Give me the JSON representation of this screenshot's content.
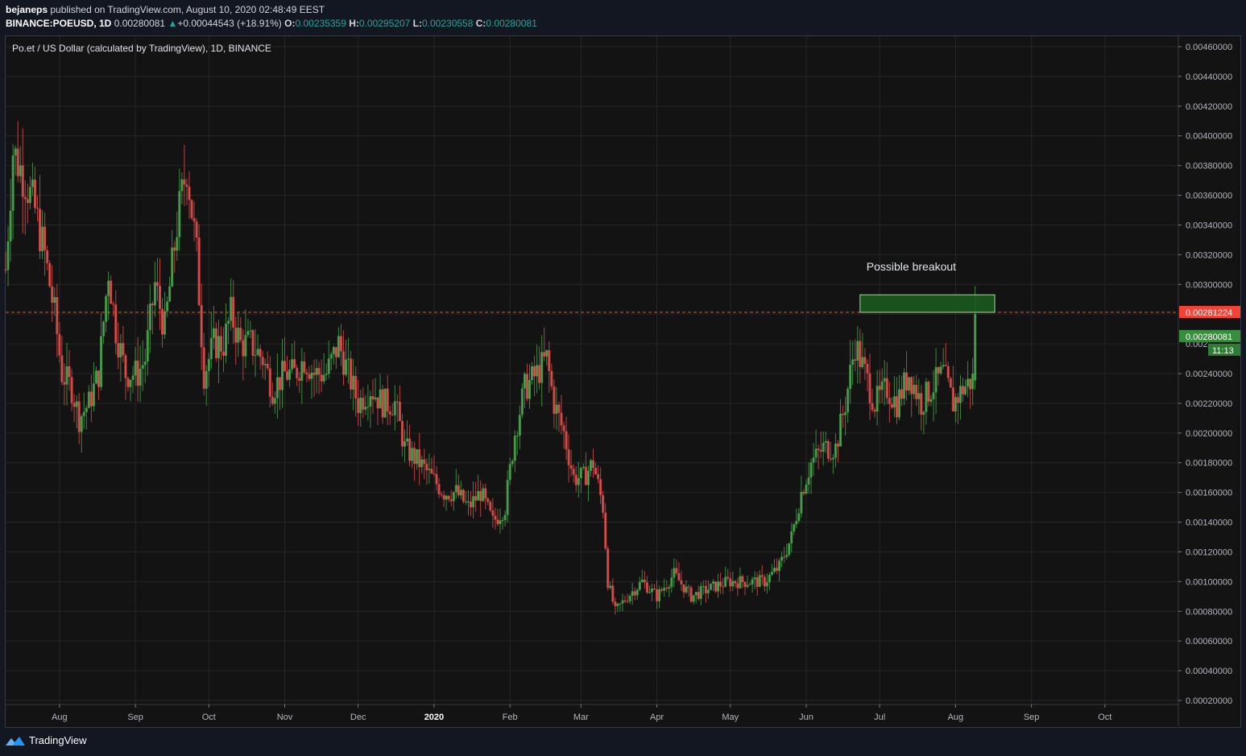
{
  "header": {
    "author": "bejaneps",
    "published_text": "published on TradingView.com, August 10, 2020 02:48:49 EEST",
    "symbol": "BINANCE:POEUSD, 1D",
    "last": "0.00280081",
    "change_arrow": "▲",
    "change": "+0.00044543 (+18.91%)",
    "o_label": "O:",
    "o_value": "0.00235359",
    "h_label": "H:",
    "h_value": "0.00295207",
    "l_label": "L:",
    "l_value": "0.00230558",
    "c_label": "C:",
    "c_value": "0.00280081"
  },
  "legend": "Po.et / US Dollar (calculated by TradingView), 1D, BINANCE",
  "annotation": "Possible breakout",
  "price_labels": {
    "resistance": "0.00281224",
    "last": "0.00280081",
    "countdown": "11:13"
  },
  "footer": {
    "brand": "TradingView",
    "logo_icon": "tradingview-logo-icon"
  },
  "colors": {
    "background": "#131313",
    "grid": "#262626",
    "up": "#4caf50",
    "down": "#ef5350",
    "resistance": "#f4511e",
    "breakout_box": "#1b5e20"
  },
  "chart_data": {
    "type": "candlestick",
    "yaxis": {
      "ylim": [
        0.0002,
        0.0046
      ],
      "ticks": [
        "0.00460000",
        "0.00440000",
        "0.00420000",
        "0.00400000",
        "0.00380000",
        "0.00360000",
        "0.00340000",
        "0.00320000",
        "0.00300000",
        "0.00240000",
        "0.00220000",
        "0.00200000",
        "0.00180000",
        "0.00160000",
        "0.00140000",
        "0.00120000",
        "0.00100000",
        "0.00080000",
        "0.00060000",
        "0.00040000",
        "0.00020000"
      ],
      "tick_values": [
        0.0046,
        0.0044,
        0.0042,
        0.004,
        0.0038,
        0.0036,
        0.0034,
        0.0032,
        0.003,
        0.0024,
        0.0022,
        0.002,
        0.0018,
        0.0016,
        0.0014,
        0.0012,
        0.001,
        0.0008,
        0.0006,
        0.0004,
        0.0002
      ]
    },
    "xaxis": {
      "range": [
        "2019-07-10",
        "2020-10-31"
      ],
      "ticks": [
        {
          "label": "Aug",
          "date": "2019-08-01"
        },
        {
          "label": "Sep",
          "date": "2019-09-01"
        },
        {
          "label": "Oct",
          "date": "2019-10-01"
        },
        {
          "label": "Nov",
          "date": "2019-11-01"
        },
        {
          "label": "Dec",
          "date": "2019-12-01"
        },
        {
          "label": "2020",
          "date": "2020-01-01",
          "bold": true
        },
        {
          "label": "Feb",
          "date": "2020-02-01"
        },
        {
          "label": "Mar",
          "date": "2020-03-01"
        },
        {
          "label": "Apr",
          "date": "2020-04-01"
        },
        {
          "label": "May",
          "date": "2020-05-01"
        },
        {
          "label": "Jun",
          "date": "2020-06-01"
        },
        {
          "label": "Jul",
          "date": "2020-07-01"
        },
        {
          "label": "Aug",
          "date": "2020-08-01"
        },
        {
          "label": "Sep",
          "date": "2020-09-01"
        },
        {
          "label": "Oct",
          "date": "2020-10-01"
        }
      ]
    },
    "series": {
      "close_path": [
        [
          "2019-07-10",
          0.0031
        ],
        [
          "2019-07-13",
          0.0039
        ],
        [
          "2019-07-18",
          0.0037
        ],
        [
          "2019-07-22",
          0.0035
        ],
        [
          "2019-07-26",
          0.0032
        ],
        [
          "2019-07-30",
          0.0028
        ],
        [
          "2019-08-02",
          0.0024
        ],
        [
          "2019-08-06",
          0.0023
        ],
        [
          "2019-08-09",
          0.0021
        ],
        [
          "2019-08-13",
          0.0022
        ],
        [
          "2019-08-17",
          0.0024
        ],
        [
          "2019-08-21",
          0.0031
        ],
        [
          "2019-08-24",
          0.0027
        ],
        [
          "2019-08-28",
          0.0024
        ],
        [
          "2019-09-02",
          0.0024
        ],
        [
          "2019-09-05",
          0.0025
        ],
        [
          "2019-09-09",
          0.003
        ],
        [
          "2019-09-13",
          0.0027
        ],
        [
          "2019-09-18",
          0.0034
        ],
        [
          "2019-09-22",
          0.0038
        ],
        [
          "2019-09-26",
          0.0032
        ],
        [
          "2019-09-29",
          0.0024
        ],
        [
          "2019-10-03",
          0.0026
        ],
        [
          "2019-10-07",
          0.0026
        ],
        [
          "2019-10-10",
          0.0028
        ],
        [
          "2019-10-14",
          0.0026
        ],
        [
          "2019-10-18",
          0.0026
        ],
        [
          "2019-10-23",
          0.0025
        ],
        [
          "2019-10-27",
          0.0023
        ],
        [
          "2019-11-01",
          0.0024
        ],
        [
          "2019-11-05",
          0.0024
        ],
        [
          "2019-11-09",
          0.0025
        ],
        [
          "2019-11-13",
          0.0024
        ],
        [
          "2019-11-18",
          0.0024
        ],
        [
          "2019-11-23",
          0.0026
        ],
        [
          "2019-11-27",
          0.0024
        ],
        [
          "2019-12-01",
          0.0022
        ],
        [
          "2019-12-06",
          0.0023
        ],
        [
          "2019-12-11",
          0.0022
        ],
        [
          "2019-12-16",
          0.0022
        ],
        [
          "2019-12-20",
          0.0019
        ],
        [
          "2019-12-26",
          0.0018
        ],
        [
          "2019-12-31",
          0.0017
        ],
        [
          "2020-01-05",
          0.0016
        ],
        [
          "2020-01-10",
          0.0016
        ],
        [
          "2020-01-15",
          0.0015
        ],
        [
          "2020-01-20",
          0.0016
        ],
        [
          "2020-01-25",
          0.0014
        ],
        [
          "2020-01-30",
          0.0015
        ],
        [
          "2020-02-03",
          0.002
        ],
        [
          "2020-02-07",
          0.0023
        ],
        [
          "2020-02-12",
          0.0024
        ],
        [
          "2020-02-16",
          0.0025
        ],
        [
          "2020-02-19",
          0.0022
        ],
        [
          "2020-02-23",
          0.002
        ],
        [
          "2020-02-27",
          0.0017
        ],
        [
          "2020-03-02",
          0.0017
        ],
        [
          "2020-03-06",
          0.0018
        ],
        [
          "2020-03-10",
          0.0015
        ],
        [
          "2020-03-12",
          0.001
        ],
        [
          "2020-03-15",
          0.0008
        ],
        [
          "2020-03-20",
          0.0009
        ],
        [
          "2020-03-26",
          0.001
        ],
        [
          "2020-04-01",
          0.0009
        ],
        [
          "2020-04-08",
          0.00105
        ],
        [
          "2020-04-15",
          0.0009
        ],
        [
          "2020-04-22",
          0.00095
        ],
        [
          "2020-04-30",
          0.001
        ],
        [
          "2020-05-08",
          0.001
        ],
        [
          "2020-05-15",
          0.001
        ],
        [
          "2020-05-21",
          0.0011
        ],
        [
          "2020-05-26",
          0.0013
        ],
        [
          "2020-05-30",
          0.0016
        ],
        [
          "2020-06-03",
          0.0018
        ],
        [
          "2020-06-08",
          0.0019
        ],
        [
          "2020-06-13",
          0.0019
        ],
        [
          "2020-06-17",
          0.0022
        ],
        [
          "2020-06-21",
          0.0026
        ],
        [
          "2020-06-25",
          0.0024
        ],
        [
          "2020-06-29",
          0.0022
        ],
        [
          "2020-07-04",
          0.0023
        ],
        [
          "2020-07-08",
          0.0022
        ],
        [
          "2020-07-13",
          0.0024
        ],
        [
          "2020-07-18",
          0.0022
        ],
        [
          "2020-07-22",
          0.0023
        ],
        [
          "2020-07-27",
          0.0024
        ],
        [
          "2020-07-31",
          0.0022
        ],
        [
          "2020-08-04",
          0.0023
        ],
        [
          "2020-08-08",
          0.00236
        ],
        [
          "2020-08-09",
          0.00280081
        ]
      ]
    },
    "resistance_line": 0.00281224,
    "breakout_box": {
      "from": "2020-06-23",
      "to": "2020-08-17",
      "low": 0.00281224,
      "high": 0.00293
    }
  }
}
